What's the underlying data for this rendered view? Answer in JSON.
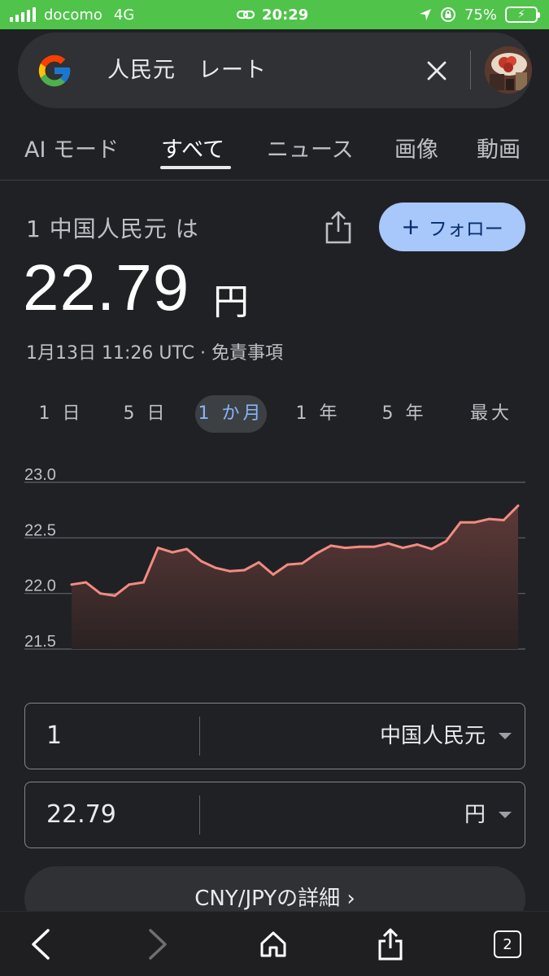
{
  "status_bar": {
    "carrier": "docomo",
    "network": "4G",
    "time": "20:29",
    "battery": "75%"
  },
  "search": {
    "query": "人民元　レート"
  },
  "tabs": [
    {
      "label": "AI モード",
      "active": false
    },
    {
      "label": "すべて",
      "active": true
    },
    {
      "label": "ニュース",
      "active": false
    },
    {
      "label": "画像",
      "active": false
    },
    {
      "label": "動画",
      "active": false
    }
  ],
  "quote": {
    "headline": "1 中国人民元 は",
    "value": "22.79",
    "unit": "円",
    "timestamp": "1月13日 11:26 UTC · 免責事項",
    "follow_label": "フォロー"
  },
  "ranges": [
    {
      "label": "1 日",
      "active": false
    },
    {
      "label": "5 日",
      "active": false
    },
    {
      "label": "1 か月",
      "active": true
    },
    {
      "label": "1 年",
      "active": false
    },
    {
      "label": "5 年",
      "active": false
    },
    {
      "label": "最大",
      "active": false
    }
  ],
  "chart_data": {
    "type": "area",
    "title": "",
    "xlabel": "",
    "ylabel": "",
    "ylim": [
      21.5,
      23.0
    ],
    "yticks": [
      "23.0",
      "22.5",
      "22.0",
      "21.5"
    ],
    "grid": true,
    "color": "#f28b82",
    "values": [
      22.08,
      22.1,
      22.0,
      21.98,
      22.08,
      22.1,
      22.41,
      22.37,
      22.4,
      22.29,
      22.23,
      22.2,
      22.21,
      22.28,
      22.17,
      22.26,
      22.27,
      22.36,
      22.43,
      22.41,
      22.42,
      22.42,
      22.45,
      22.41,
      22.44,
      22.4,
      22.47,
      22.64,
      22.64,
      22.67,
      22.66,
      22.79
    ]
  },
  "converter": {
    "from_amount": "1",
    "from_currency": "中国人民元",
    "to_amount": "22.79",
    "to_currency": "円"
  },
  "details_button": "CNY/JPYの詳細 ›",
  "toolbar": {
    "tab_count": "2"
  }
}
